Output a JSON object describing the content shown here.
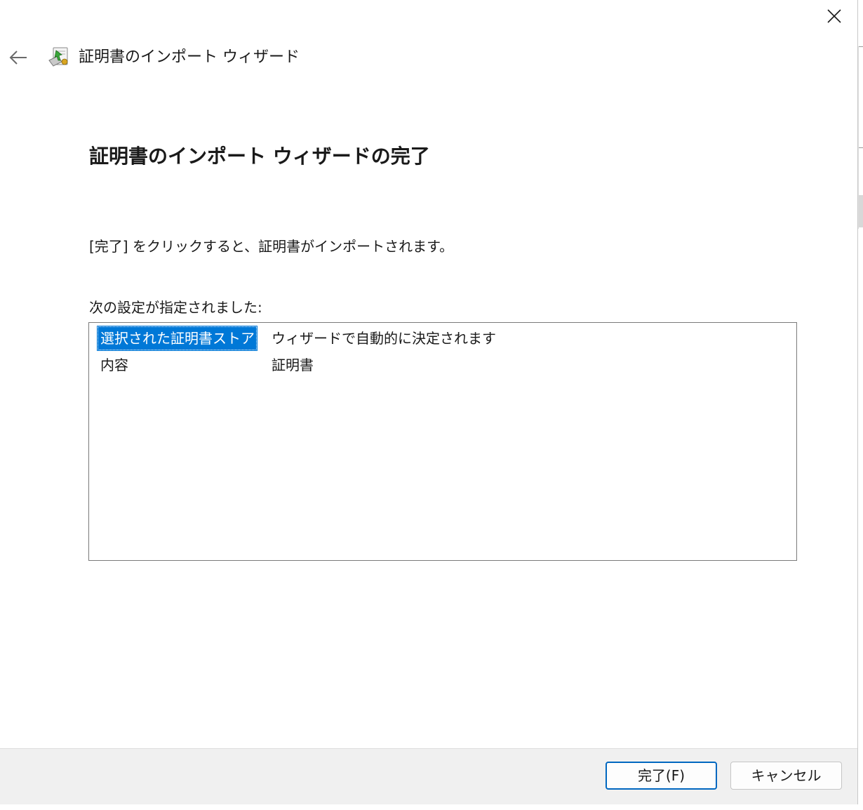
{
  "window": {
    "title": "証明書のインポート ウィザード"
  },
  "page": {
    "heading": "証明書のインポート ウィザードの完了",
    "instruction": "[完了] をクリックすると、証明書がインポートされます。",
    "settings_label": "次の設定が指定されました:",
    "settings": [
      {
        "key": "選択された証明書ストア",
        "value": "ウィザードで自動的に決定されます",
        "selected": true
      },
      {
        "key": "内容",
        "value": "証明書",
        "selected": false
      }
    ]
  },
  "footer": {
    "finish_label": "完了(F)",
    "cancel_label": "キャンセル"
  },
  "icons": {
    "close": "close-icon",
    "back": "back-arrow-icon",
    "wizard": "certificate-wizard-icon"
  },
  "colors": {
    "selection": "#0078d7",
    "primary_border": "#0067c0",
    "footer_bg": "#f0f0f0"
  }
}
